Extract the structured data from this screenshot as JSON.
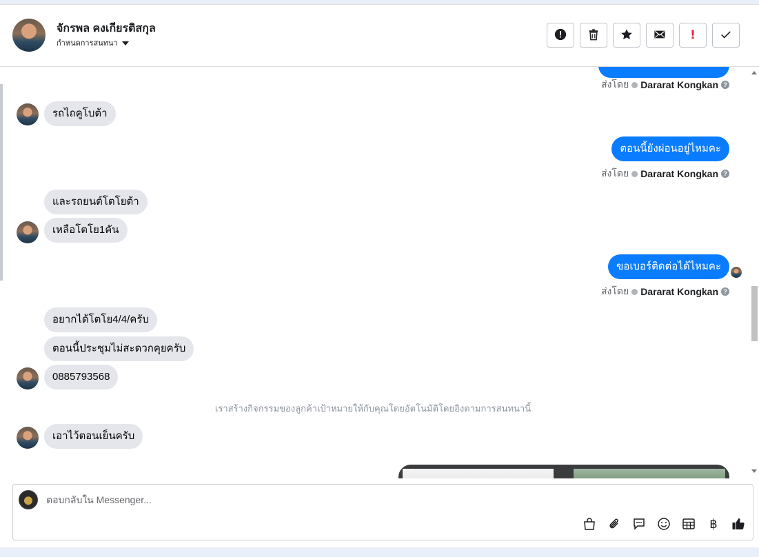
{
  "header": {
    "contact_name": "จักรพล คงเกียรติสกุล",
    "subtitle": "กำหนดการสนทนา",
    "actions": [
      {
        "name": "spam-button",
        "icon": "alert-circle-icon"
      },
      {
        "name": "delete-button",
        "icon": "trash-icon"
      },
      {
        "name": "star-button",
        "icon": "star-icon"
      },
      {
        "name": "mark-unread-button",
        "icon": "envelope-icon"
      },
      {
        "name": "follow-up-button",
        "icon": "exclamation-icon",
        "label": "!"
      },
      {
        "name": "mark-done-button",
        "icon": "checkmark-icon"
      }
    ]
  },
  "messages": {
    "m1": "รถไถคูโบต้า",
    "m2": "ตอนนี้ยังผ่อนอยู่ไหมคะ",
    "m3": "และรถยนต์โตโยต้า",
    "m4": "เหลือโตโย1คัน",
    "m5": "ขอเบอร์ติดต่อได้ไหมคะ",
    "m6": "อยากได้โตโย4/4/ครับ",
    "m7": "ตอนนี้ประชุมไม่สะดวกคุยครับ",
    "m8": "0885793568",
    "m9": "เอาไว้ตอนเย็นครับ",
    "sent_by_label": "ส่งโดย",
    "sent_by_name": "Dararat Kongkan",
    "system_notice": "เราสร้างกิจกรรมของลูกค้าเป้าหมายให้กับคุณโดยอัตโนมัติโดยอิงตามการสนทนานี้"
  },
  "composer": {
    "placeholder": "ตอบกลับใน Messenger...",
    "tools": [
      "shop-icon",
      "paperclip-icon",
      "speech-bubble-icon",
      "emoji-icon",
      "table-icon",
      "baht-icon",
      "thumbs-up-icon"
    ],
    "baht_symbol": "฿"
  },
  "colors": {
    "outgoing_bubble": "#0a7cff",
    "incoming_bubble": "#e4e6eb",
    "alert_red": "#e41e3f"
  }
}
